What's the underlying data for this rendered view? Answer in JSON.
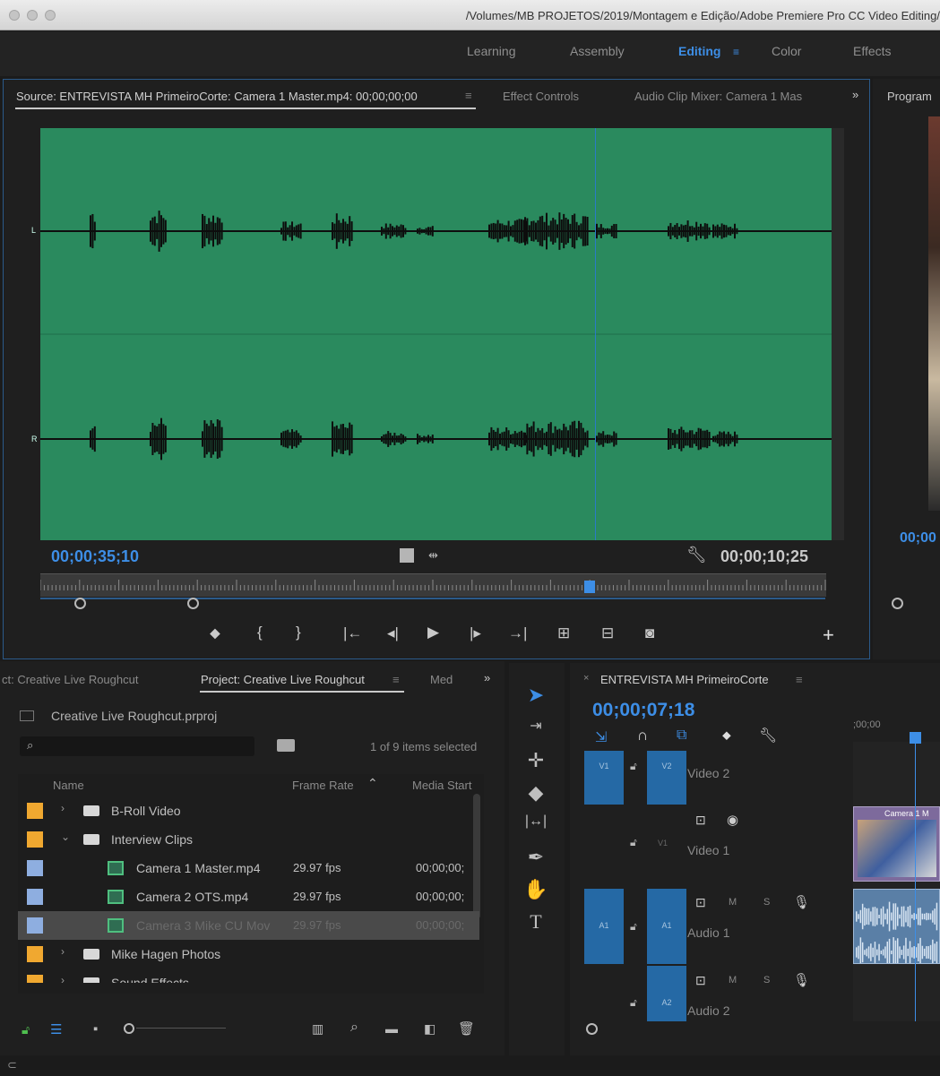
{
  "title_path": "/Volumes/MB PROJETOS/2019/Montagem e Edição/Adobe Premiere Pro CC Video Editing/",
  "workspaces": [
    "Learning",
    "Assembly",
    "Editing",
    "Color",
    "Effects"
  ],
  "workspace_active": "Editing",
  "source_panel": {
    "tabs": [
      "Source: ENTREVISTA MH PrimeiroCorte: Camera 1 Master.mp4: 00;00;00;00",
      "Effect Controls",
      "Audio Clip Mixer: Camera 1 Mas"
    ],
    "channel_labels": [
      "L",
      "R"
    ],
    "timecode_left": "00;00;35;10",
    "timecode_right": "00;00;10;25",
    "overflow": "»"
  },
  "program_panel": {
    "tab": "Program",
    "timecode": "00;00"
  },
  "project_panel": {
    "tabs": [
      "ct: Creative Live Roughcut",
      "Project: Creative Live Roughcut",
      "Med"
    ],
    "project_file": "Creative Live Roughcut.prproj",
    "items_selected": "1 of 9 items selected",
    "columns": [
      "Name",
      "Frame Rate",
      "Media Start"
    ],
    "rows": [
      {
        "name": "B-Roll Video",
        "type": "folder",
        "rate": "",
        "start": "",
        "color": "#f0a830",
        "indent": 0,
        "open": false,
        "selected": false
      },
      {
        "name": "Interview Clips",
        "type": "folder",
        "rate": "",
        "start": "",
        "color": "#f0a830",
        "indent": 0,
        "open": true,
        "selected": false
      },
      {
        "name": "Camera 1 Master.mp4",
        "type": "clip",
        "rate": "29.97 fps",
        "start": "00;00;00;",
        "color": "#8eaee0",
        "indent": 1,
        "open": false,
        "selected": false
      },
      {
        "name": "Camera 2 OTS.mp4",
        "type": "clip",
        "rate": "29.97 fps",
        "start": "00;00;00;",
        "color": "#8eaee0",
        "indent": 1,
        "open": false,
        "selected": false
      },
      {
        "name": "Camera 3 Mike CU Mov",
        "type": "clip",
        "rate": "29.97 fps",
        "start": "00;00;00;",
        "color": "#8eaee0",
        "indent": 1,
        "open": false,
        "selected": true
      },
      {
        "name": "Mike Hagen Photos",
        "type": "folder",
        "rate": "",
        "start": "",
        "color": "#f0a830",
        "indent": 0,
        "open": false,
        "selected": false
      },
      {
        "name": "Sound Effects",
        "type": "folder",
        "rate": "",
        "start": "",
        "color": "#f0a830",
        "indent": 0,
        "open": false,
        "selected": false
      }
    ]
  },
  "timeline_panel": {
    "sequence_name": "ENTREVISTA MH PrimeiroCorte",
    "timecode": "00;00;07;18",
    "ruler_start": ";00;00",
    "tracks": [
      {
        "src": "V1",
        "tgt": "V2",
        "name": "Video 2"
      },
      {
        "src": "",
        "tgt": "V1",
        "name": "Video 1"
      },
      {
        "src": "A1",
        "tgt": "A1",
        "name": "Audio 1"
      },
      {
        "src": "",
        "tgt": "A2",
        "name": "Audio 2"
      }
    ],
    "clip_label": "Camera 1 M",
    "track_btn_m": "M",
    "track_btn_s": "S"
  }
}
